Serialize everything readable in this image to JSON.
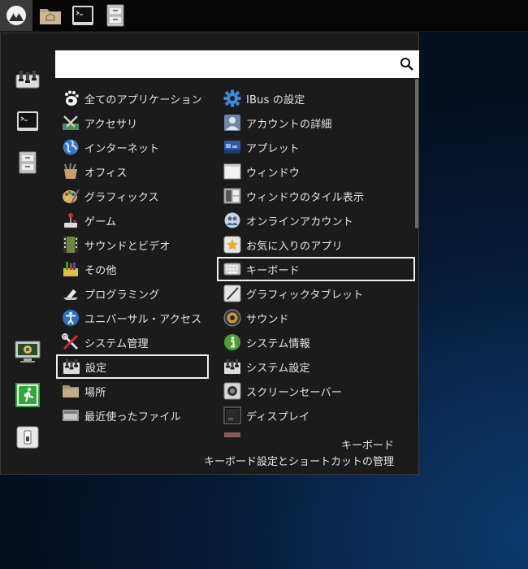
{
  "colors": {
    "panel": "#060606",
    "menu_bg": "#1b1b1b",
    "text": "#e6e6e6",
    "selection_border": "#f0f0f0",
    "desktop": "#0a2a52"
  },
  "panel": {
    "buttons": [
      {
        "name": "menu-button",
        "icon": "distro-logo-icon"
      },
      {
        "name": "file-manager-launcher",
        "icon": "home-folder-icon"
      },
      {
        "name": "terminal-launcher",
        "icon": "terminal-icon"
      },
      {
        "name": "cabinet-launcher",
        "icon": "file-cabinet-icon"
      }
    ]
  },
  "menu": {
    "search": {
      "value": "",
      "placeholder": ""
    },
    "favorites": [
      {
        "name": "settings-fav",
        "icon": "settings-icon"
      },
      {
        "name": "terminal-fav",
        "icon": "terminal-icon"
      },
      {
        "name": "files-fav",
        "icon": "file-cabinet-icon"
      },
      {
        "name": "lock-screen",
        "icon": "lock-screen-icon"
      },
      {
        "name": "logout",
        "icon": "exit-icon"
      },
      {
        "name": "shutdown",
        "icon": "power-icon"
      }
    ],
    "categories": [
      {
        "label": "全てのアプリケーション",
        "icon": "gnome-foot-icon"
      },
      {
        "label": "アクセサリ",
        "icon": "accessories-icon"
      },
      {
        "label": "インターネット",
        "icon": "globe-icon"
      },
      {
        "label": "オフィス",
        "icon": "office-icon"
      },
      {
        "label": "グラフィックス",
        "icon": "palette-icon"
      },
      {
        "label": "ゲーム",
        "icon": "joystick-icon"
      },
      {
        "label": "サウンドとビデオ",
        "icon": "film-icon"
      },
      {
        "label": "その他",
        "icon": "misc-icon"
      },
      {
        "label": "プログラミング",
        "icon": "programming-icon"
      },
      {
        "label": "ユニバーサル・アクセス",
        "icon": "accessibility-icon"
      },
      {
        "label": "システム管理",
        "icon": "tools-icon"
      },
      {
        "label": "設定",
        "icon": "settings-icon",
        "selected": true
      },
      {
        "label": "場所",
        "icon": "folder-icon"
      },
      {
        "label": "最近使ったファイル",
        "icon": "recent-files-icon"
      }
    ],
    "apps": [
      {
        "label": "IBus の設定",
        "icon": "gear-icon"
      },
      {
        "label": "アカウントの詳細",
        "icon": "user-icon"
      },
      {
        "label": "アプレット",
        "icon": "applet-icon"
      },
      {
        "label": "ウィンドウ",
        "icon": "window-icon"
      },
      {
        "label": "ウィンドウのタイル表示",
        "icon": "tile-icon"
      },
      {
        "label": "オンラインアカウント",
        "icon": "online-accounts-icon"
      },
      {
        "label": "お気に入りのアプリ",
        "icon": "star-icon"
      },
      {
        "label": "キーボード",
        "icon": "keyboard-icon",
        "selected": true
      },
      {
        "label": "グラフィックタブレット",
        "icon": "tablet-icon"
      },
      {
        "label": "サウンド",
        "icon": "speaker-icon"
      },
      {
        "label": "システム情報",
        "icon": "info-icon"
      },
      {
        "label": "システム設定",
        "icon": "settings-icon"
      },
      {
        "label": "スクリーンセーバー",
        "icon": "screensaver-icon"
      },
      {
        "label": "ディスプレイ",
        "icon": "display-icon"
      }
    ],
    "description": {
      "title": "キーボード",
      "text": "キーボード設定とショートカットの管理"
    }
  }
}
